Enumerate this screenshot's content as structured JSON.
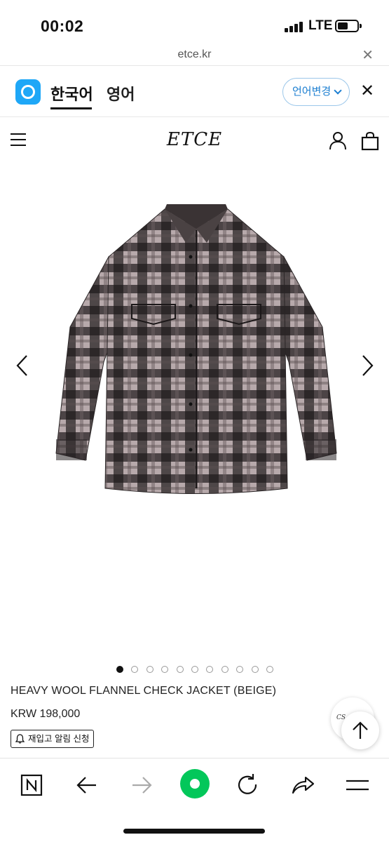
{
  "status_bar": {
    "time": "00:02",
    "network": "LTE"
  },
  "url_bar": {
    "domain": "etce.kr",
    "close_icon": "x-icon"
  },
  "translate_bar": {
    "languages": [
      "한국어",
      "영어"
    ],
    "selected": "한국어",
    "change_label": "언어변경",
    "app_icon": "papago-icon",
    "accent_color": "#1ea7f7"
  },
  "site_header": {
    "logo": "ETCE",
    "icons": [
      "menu-icon",
      "user-icon",
      "cart-icon"
    ]
  },
  "product": {
    "name": "HEAVY WOOL FLANNEL CHECK JACKET (BEIGE)",
    "price": "KRW 198,000",
    "restock_label": "재입고 알림 신청",
    "image_count": 11,
    "active_image": 1
  },
  "floating": {
    "cs_label": "CS",
    "top_icon": "arrow-up-icon"
  },
  "toolbar": {
    "icons": [
      "naver-home-icon",
      "back-icon",
      "forward-icon",
      "green-dot-icon",
      "refresh-icon",
      "share-icon",
      "menu-icon"
    ],
    "accent_color": "#03c75a"
  }
}
